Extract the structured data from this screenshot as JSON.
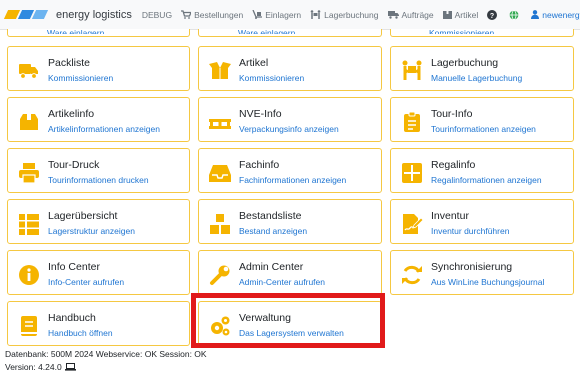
{
  "nav": {
    "brand": "energy logistics",
    "logo_colors": [
      "#f5b400",
      "#2f8ae0",
      "#6cb4f0"
    ],
    "items": [
      {
        "label": "DEBUG",
        "icon": ""
      },
      {
        "label": "Bestellungen",
        "icon": "cart-icon"
      },
      {
        "label": "Einlagern",
        "icon": "dolly-icon"
      },
      {
        "label": "Lagerbuchung",
        "icon": "people-carry-icon"
      },
      {
        "label": "Aufträge",
        "icon": "truck-icon"
      },
      {
        "label": "Artikel",
        "icon": "box-icon"
      }
    ],
    "help_icon": "question-circle-icon",
    "lang_icon": "globe-icon",
    "user": "newenergy",
    "user_icon": "user-icon"
  },
  "tiles": [
    {
      "title": "Packliste",
      "sub": "Kommissionieren",
      "icon": "truck-icon"
    },
    {
      "title": "Artikel",
      "sub": "Kommissionieren",
      "icon": "box-open-icon"
    },
    {
      "title": "Lagerbuchung",
      "sub": "Manuelle Lagerbuchung",
      "icon": "people-carry-icon"
    },
    {
      "title": "Artikelinfo",
      "sub": "Artikelinformationen anzeigen",
      "icon": "box-icon"
    },
    {
      "title": "NVE-Info",
      "sub": "Verpackungsinfo anzeigen",
      "icon": "pallet-icon"
    },
    {
      "title": "Tour-Info",
      "sub": "Tourinformationen anzeigen",
      "icon": "clipboard-list-icon"
    },
    {
      "title": "Tour-Druck",
      "sub": "Tourinformationen drucken",
      "icon": "print-icon"
    },
    {
      "title": "Fachinfo",
      "sub": "Fachinformationen anzeigen",
      "icon": "inbox-icon"
    },
    {
      "title": "Regalinfo",
      "sub": "Regalinformationen anzeigen",
      "icon": "grid-icon"
    },
    {
      "title": "Lagerübersicht",
      "sub": "Lagerstruktur anzeigen",
      "icon": "th-list-icon"
    },
    {
      "title": "Bestandsliste",
      "sub": "Bestand anzeigen",
      "icon": "cubes-icon"
    },
    {
      "title": "Inventur",
      "sub": "Inventur durchführen",
      "icon": "file-signature-icon"
    },
    {
      "title": "Info Center",
      "sub": "Info-Center aufrufen",
      "icon": "info-circle-icon"
    },
    {
      "title": "Admin Center",
      "sub": "Admin-Center aufrufen",
      "icon": "wrench-icon"
    },
    {
      "title": "Synchronisierung",
      "sub": "Aus WinLine Buchungsjournal",
      "icon": "sync-icon"
    },
    {
      "title": "Handbuch",
      "sub": "Handbuch öffnen",
      "icon": "book-icon"
    },
    {
      "title": "Verwaltung",
      "sub": "Das Lagersystem verwalten",
      "icon": "cogs-icon"
    }
  ],
  "top_fragments": [
    "Ware einlagern",
    "Ware einlagern",
    "Kommissionieren"
  ],
  "footer": {
    "line1": "Datenbank: 500M 2024 Webservice: OK Session: OK",
    "line2": "Version: 4.24.0",
    "version_icon": "laptop-icon"
  },
  "colors": {
    "accent": "#f5b400",
    "link": "#2076d2",
    "tile_border": "#f5c842",
    "highlight": "#e11a1a"
  }
}
